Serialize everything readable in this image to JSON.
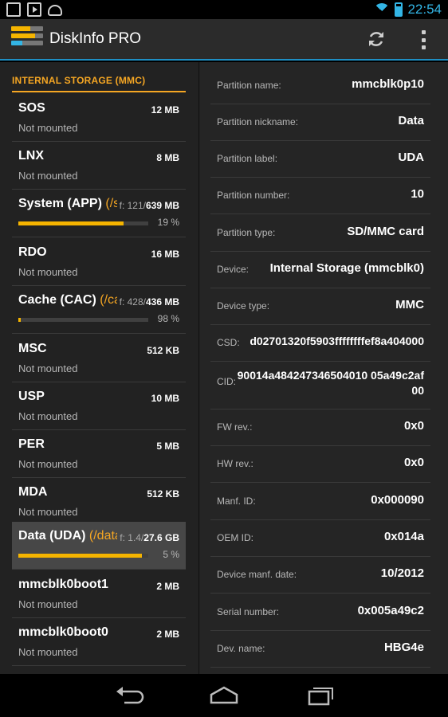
{
  "status_bar": {
    "icons": [
      "picture-icon",
      "play-store-icon",
      "android-icon"
    ],
    "time": "22:54",
    "colors": {
      "accent": "#33b5e5"
    }
  },
  "action_bar": {
    "title": "DiskInfo PRO",
    "actions": [
      "refresh-icon",
      "overflow-menu-icon"
    ]
  },
  "storage": {
    "header": "INTERNAL STORAGE (MMC)",
    "partitions": [
      {
        "name": "SOS",
        "mount": "",
        "size": "12 MB",
        "free": "",
        "status": "Not mounted"
      },
      {
        "name": "LNX",
        "mount": "",
        "size": "8 MB",
        "free": "",
        "status": "Not mounted"
      },
      {
        "name": "System (APP)",
        "mount": " (/s...",
        "size": "639 MB",
        "free": "f: 121/",
        "percent": "19 %",
        "used_fraction": 0.81
      },
      {
        "name": "RDO",
        "mount": "",
        "size": "16 MB",
        "free": "",
        "status": "Not mounted"
      },
      {
        "name": "Cache (CAC)",
        "mount": " (/cac...",
        "size": "436 MB",
        "free": "f: 428/",
        "percent": "98 %",
        "used_fraction": 0.02
      },
      {
        "name": "MSC",
        "mount": "",
        "size": "512 KB",
        "free": "",
        "status": "Not mounted"
      },
      {
        "name": "USP",
        "mount": "",
        "size": "10 MB",
        "free": "",
        "status": "Not mounted"
      },
      {
        "name": "PER",
        "mount": "",
        "size": "5 MB",
        "free": "",
        "status": "Not mounted"
      },
      {
        "name": "MDA",
        "mount": "",
        "size": "512 KB",
        "free": "",
        "status": "Not mounted"
      },
      {
        "name": "Data (UDA)",
        "mount": " (/data)",
        "size": "27.6 GB",
        "free": "f: 1.4/",
        "percent": "5 %",
        "used_fraction": 0.95,
        "selected": true
      },
      {
        "name": "mmcblk0boot1",
        "mount": "",
        "size": "2 MB",
        "free": "",
        "status": "Not mounted"
      },
      {
        "name": "mmcblk0boot0",
        "mount": "",
        "size": "2 MB",
        "free": "",
        "status": "Not mounted"
      }
    ]
  },
  "details": [
    {
      "label": "Partition name:",
      "value": "mmcblk0p10"
    },
    {
      "label": "Partition nickname:",
      "value": "Data"
    },
    {
      "label": "Partition label:",
      "value": "UDA"
    },
    {
      "label": "Partition number:",
      "value": "10"
    },
    {
      "label": "Partition type:",
      "value": "SD/MMC card"
    },
    {
      "label": "Device:",
      "value": "Internal Storage (mmcblk0)"
    },
    {
      "label": "Device type:",
      "value": "MMC"
    },
    {
      "label": "CSD:",
      "value": "d02701320f5903ffffffffef8a404000"
    },
    {
      "label": "CID:",
      "value": "90014a484247346504010 05a49c2af00",
      "tall": true
    },
    {
      "label": "FW rev.:",
      "value": "0x0"
    },
    {
      "label": "HW rev.:",
      "value": "0x0"
    },
    {
      "label": "Manf. ID:",
      "value": "0x000090"
    },
    {
      "label": "OEM ID:",
      "value": "0x014a"
    },
    {
      "label": "Device manf. date:",
      "value": "10/2012"
    },
    {
      "label": "Serial number:",
      "value": "0x005a49c2"
    },
    {
      "label": "Dev. name:",
      "value": "HBG4e"
    }
  ],
  "nav_bar": {
    "buttons": [
      "back-icon",
      "home-icon",
      "recent-apps-icon"
    ]
  },
  "colors": {
    "accent_orange": "#f5a623",
    "progress_yellow": "#f5b400",
    "holo_blue": "#33b5e5"
  }
}
